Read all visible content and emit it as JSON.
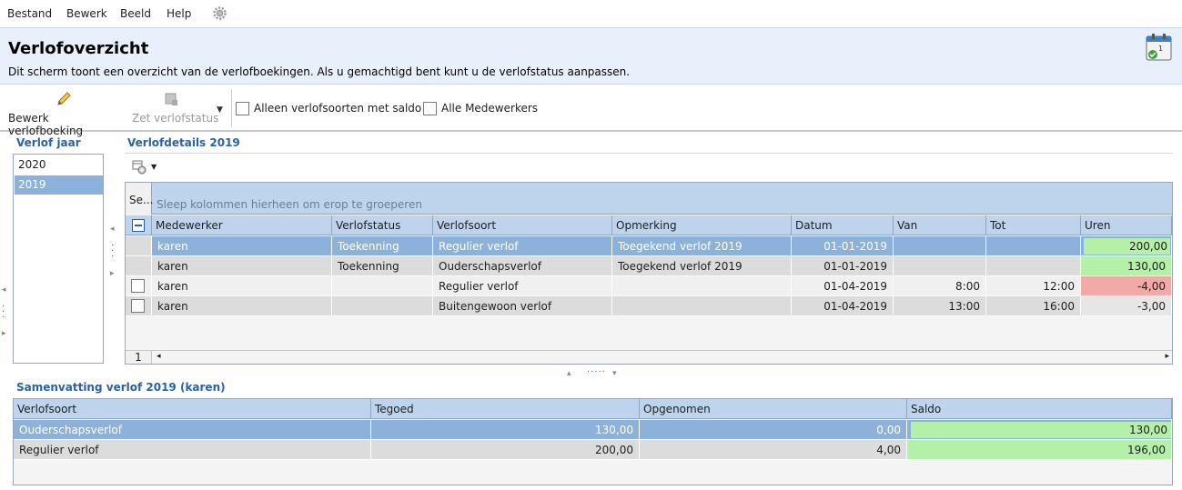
{
  "menu": {
    "items": [
      "Bestand",
      "Bewerk",
      "Beeld",
      "Help"
    ]
  },
  "header": {
    "title": "Verlofoverzicht",
    "description": "Dit scherm toont een overzicht van de verlofboekingen. Als u gemachtigd bent kunt u de verlofstatus aanpassen."
  },
  "toolbar": {
    "edit_label": "Bewerk verlofboeking",
    "set_status_label": "Zet verlofstatus",
    "only_saldo_label": "Alleen verlofsoorten met saldo",
    "all_employees_label": "Alle Medewerkers"
  },
  "years": {
    "title": "Verlof jaar",
    "items": [
      "2020",
      "2019"
    ],
    "selected": "2019"
  },
  "details": {
    "title": "Verlofdetails 2019",
    "group_hint": "Sleep kolommen hierheen om erop te groeperen",
    "select_col": "Se...",
    "columns": [
      "Medewerker",
      "Verlofstatus",
      "Verlofsoort",
      "Opmerking",
      "Datum",
      "Van",
      "Tot",
      "Uren"
    ],
    "rows": [
      [
        "karen",
        "Toekenning",
        "Regulier verlof",
        "Toegekend verlof 2019",
        "01-01-2019",
        "",
        "",
        "200,00"
      ],
      [
        "karen",
        "Toekenning",
        "Ouderschapsverlof",
        "Toegekend verlof 2019",
        "01-01-2019",
        "",
        "",
        "130,00"
      ],
      [
        "karen",
        "",
        "Regulier verlof",
        "",
        "01-04-2019",
        "8:00",
        "12:00",
        "-4,00"
      ],
      [
        "karen",
        "",
        "Buitengewoon verlof",
        "",
        "01-04-2019",
        "13:00",
        "16:00",
        "-3,00"
      ]
    ],
    "page_number": "1"
  },
  "summary": {
    "title": "Samenvatting verlof 2019 (karen)",
    "columns": [
      "Verlofsoort",
      "Tegoed",
      "Opgenomen",
      "Saldo"
    ],
    "rows": [
      [
        "Ouderschapsverlof",
        "130,00",
        "0,00",
        "130,00"
      ],
      [
        "Regulier verlof",
        "200,00",
        "4,00",
        "196,00"
      ]
    ]
  },
  "colors": {
    "accent": "#2a62a6",
    "selected_row": "#8cb2dc",
    "positive": "#b4f0a8",
    "negative": "#f2aaa8"
  }
}
